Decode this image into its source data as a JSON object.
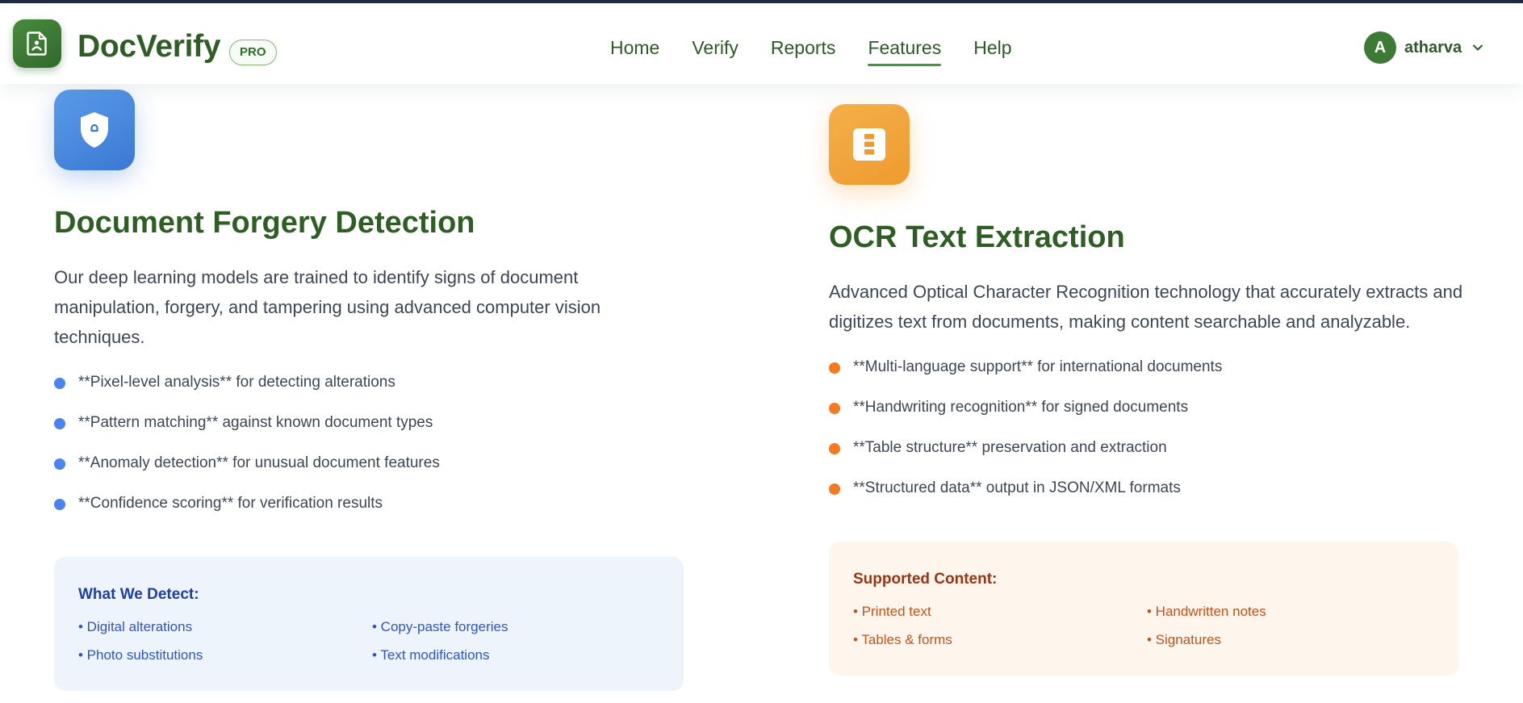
{
  "header": {
    "brand": "DocVerify",
    "badge": "PRO",
    "nav": [
      {
        "label": "Home",
        "active": false
      },
      {
        "label": "Verify",
        "active": false
      },
      {
        "label": "Reports",
        "active": false
      },
      {
        "label": "Features",
        "active": true
      },
      {
        "label": "Help",
        "active": false
      }
    ],
    "user": {
      "initial": "A",
      "name": "atharva"
    }
  },
  "features": {
    "forgery": {
      "icon": "shield-icon",
      "title": "Document Forgery Detection",
      "description": "Our deep learning models are trained to identify signs of document manipulation, forgery, and tampering using advanced computer vision techniques.",
      "bullets": [
        "**Pixel-level analysis** for detecting alterations",
        "**Pattern matching** against known document types",
        "**Anomaly detection** for unusual document features",
        "**Confidence scoring** for verification results"
      ],
      "box": {
        "title": "What We Detect:",
        "items": [
          "• Digital alterations",
          "• Copy-paste forgeries",
          "• Photo substitutions",
          "• Text modifications"
        ]
      }
    },
    "ocr": {
      "icon": "document-text-icon",
      "title": "OCR Text Extraction",
      "description": "Advanced Optical Character Recognition technology that accurately extracts and digitizes text from documents, making content searchable and analyzable.",
      "bullets": [
        "**Multi-language support** for international documents",
        "**Handwriting recognition** for signed documents",
        "**Table structure** preservation and extraction",
        "**Structured data** output in JSON/XML formats"
      ],
      "box": {
        "title": "Supported Content:",
        "items": [
          "• Printed text",
          "• Handwritten notes",
          "• Tables & forms",
          "• Signatures"
        ]
      }
    }
  },
  "colors": {
    "brand_green": "#2f5e25",
    "accent_blue": "#4b84f0",
    "accent_orange": "#f47a1f",
    "nav_underline": "#3c9a3c"
  }
}
